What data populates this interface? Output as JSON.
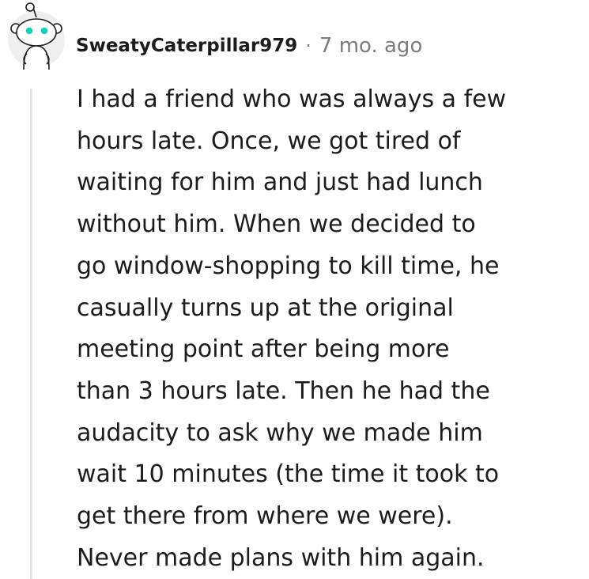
{
  "comment": {
    "author": "SweatyCaterpillar979",
    "separator": "·",
    "timestamp": "7 mo. ago",
    "avatar_icon": "reddit-snoo-avatar-icon",
    "body_lines": [
      "I had a friend who was always a few",
      "hours late. Once, we got tired of",
      "waiting for him and just had lunch",
      "without him. When we decided to",
      "go window-shopping to kill time, he",
      "casually turns up at the original",
      "meeting point after being more",
      "than 3 hours late. Then he had the",
      "audacity to ask why we made him",
      "wait 10 minutes (the time it took to",
      "get there from where we were).",
      "Never made plans with him again."
    ]
  },
  "colors": {
    "avatar_accent": "#0dd3bb",
    "avatar_bg": "#edeff1",
    "thread_line": "#e3e5e8",
    "meta_text": "#7c7c7c",
    "body_text": "#1c1c1c"
  }
}
